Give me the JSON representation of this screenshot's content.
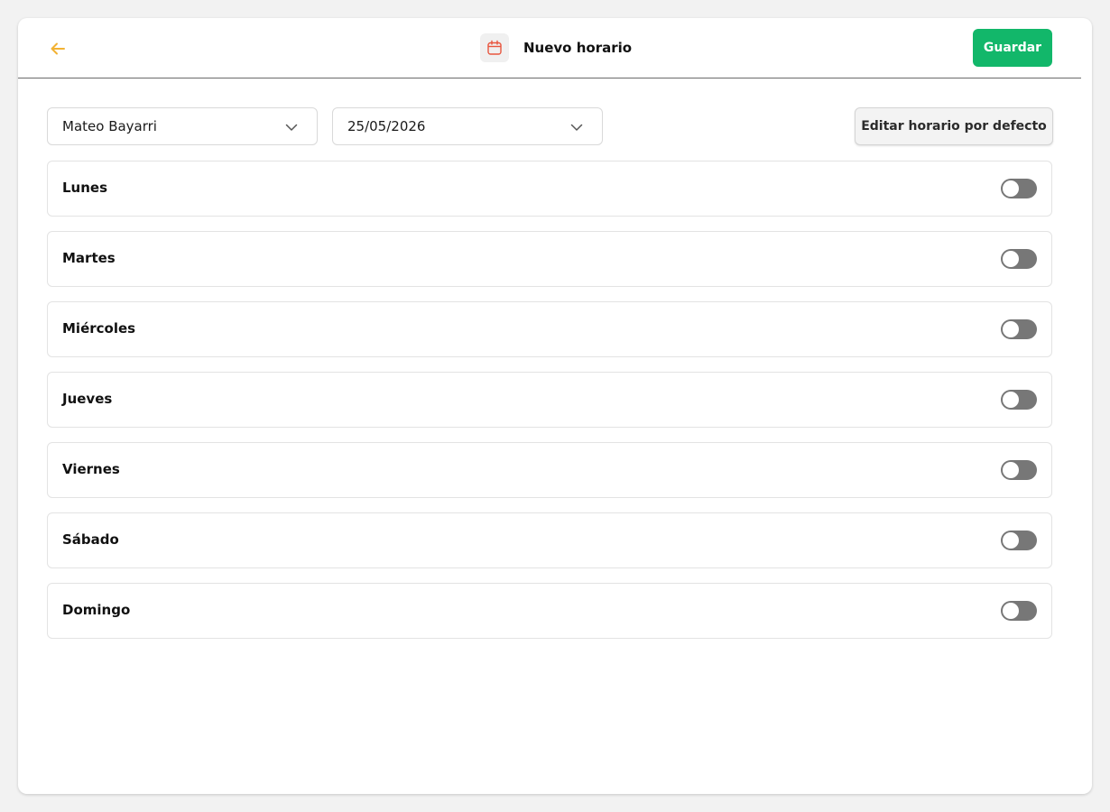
{
  "header": {
    "title": "Nuevo horario",
    "save_label": "Guardar",
    "back_icon": "arrow-left-icon",
    "title_icon": "calendar-icon"
  },
  "filters": {
    "employee_value": "Mateo Bayarri",
    "date_value": "25/05/2026",
    "edit_default_label": "Editar horario por defecto"
  },
  "days": [
    {
      "label": "Lunes",
      "enabled": false
    },
    {
      "label": "Martes",
      "enabled": false
    },
    {
      "label": "Miércoles",
      "enabled": false
    },
    {
      "label": "Jueves",
      "enabled": false
    },
    {
      "label": "Viernes",
      "enabled": false
    },
    {
      "label": "Sábado",
      "enabled": false
    },
    {
      "label": "Domingo",
      "enabled": false
    }
  ],
  "colors": {
    "accent_back_arrow": "#f2b233",
    "calendar_icon": "#e8553e",
    "save_button": "#12b76a",
    "toggle_off": "#777777"
  }
}
